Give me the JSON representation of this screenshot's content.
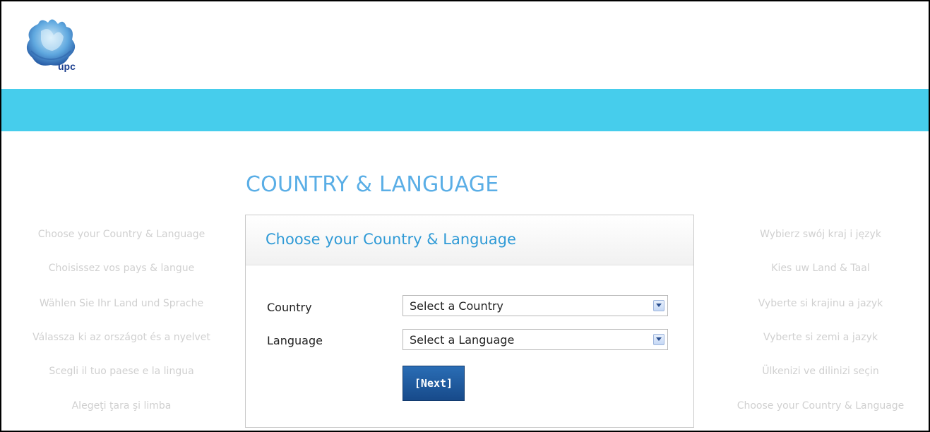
{
  "brand": {
    "logo_text": "upc",
    "band_color": "#46cdec",
    "accent": "#5aaee6"
  },
  "page": {
    "title": "COUNTRY & LANGUAGE"
  },
  "panel": {
    "title": "Choose your Country & Language",
    "country_label": "Country",
    "country_select": "Select a Country",
    "language_label": "Language",
    "language_select": "Select a Language",
    "next_label": "[Next]"
  },
  "left_phrases": [
    "Choose your Country & Language",
    "Choisissez vos pays & langue",
    "Wählen Sie Ihr Land und Sprache",
    "Válassza ki az országot és a nyelvet",
    "Scegli il tuo paese e la lingua",
    "Alegeţi ţara şi limba"
  ],
  "right_phrases": [
    "Wybierz swój kraj i język",
    "Kies uw Land & Taal",
    "Vyberte si krajinu a jazyk",
    "Vyberte si zemi a jazyk",
    "Ülkenizi ve dilinizi seçin",
    "Choose your Country & Language"
  ]
}
